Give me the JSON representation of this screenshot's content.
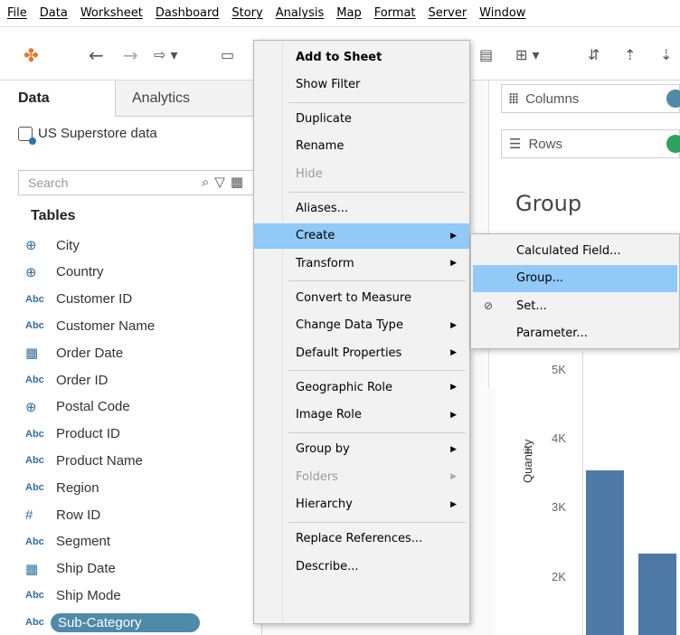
{
  "menubar": [
    "File",
    "Data",
    "Worksheet",
    "Dashboard",
    "Story",
    "Analysis",
    "Map",
    "Format",
    "Server",
    "Window"
  ],
  "tabs": {
    "data": "Data",
    "analytics": "Analytics"
  },
  "datasource": "US Superstore data",
  "search": {
    "placeholder": "Search"
  },
  "tables_header": "Tables",
  "fields": [
    {
      "icon": "globe-icon",
      "type": "geo",
      "label": "City"
    },
    {
      "icon": "globe-icon",
      "type": "geo",
      "label": "Country"
    },
    {
      "icon": "abc-icon",
      "type": "text",
      "label": "Customer ID"
    },
    {
      "icon": "abc-icon",
      "type": "text",
      "label": "Customer Name"
    },
    {
      "icon": "calendar-icon",
      "type": "date",
      "label": "Order Date"
    },
    {
      "icon": "abc-icon",
      "type": "text",
      "label": "Order ID"
    },
    {
      "icon": "globe-icon",
      "type": "geo",
      "label": "Postal Code"
    },
    {
      "icon": "abc-icon",
      "type": "text",
      "label": "Product ID"
    },
    {
      "icon": "abc-icon",
      "type": "text",
      "label": "Product Name"
    },
    {
      "icon": "abc-icon",
      "type": "text",
      "label": "Region"
    },
    {
      "icon": "hash-icon",
      "type": "number",
      "label": "Row ID"
    },
    {
      "icon": "abc-icon",
      "type": "text",
      "label": "Segment"
    },
    {
      "icon": "calendar-icon",
      "type": "date",
      "label": "Ship Date"
    },
    {
      "icon": "abc-icon",
      "type": "text",
      "label": "Ship Mode"
    },
    {
      "icon": "abc-icon",
      "type": "text",
      "label": "Sub-Category",
      "selected": true
    }
  ],
  "icon_glyphs": {
    "abc": "Abc",
    "globe": "⊕",
    "calendar": "📅",
    "hash": "#"
  },
  "shelves": {
    "columns": "Columns",
    "rows": "Rows"
  },
  "sheet_title": "Group",
  "chart": {
    "y_label": "Quantity",
    "ticks": [
      "5K",
      "4K",
      "3K",
      "2K"
    ],
    "bar_color": "#4e79a7",
    "values": [
      3550,
      2340
    ]
  },
  "context_menu": {
    "items": [
      {
        "label": "Add to Sheet",
        "bold": true
      },
      {
        "label": "Show Filter"
      },
      {
        "sep": true
      },
      {
        "label": "Duplicate"
      },
      {
        "label": "Rename"
      },
      {
        "label": "Hide",
        "disabled": true
      },
      {
        "sep": true
      },
      {
        "label": "Aliases..."
      },
      {
        "label": "Create",
        "submenu": true,
        "highlighted": true
      },
      {
        "label": "Transform",
        "submenu": true
      },
      {
        "sep": true
      },
      {
        "label": "Convert to Measure"
      },
      {
        "label": "Change Data Type",
        "submenu": true
      },
      {
        "label": "Default Properties",
        "submenu": true
      },
      {
        "sep": true
      },
      {
        "label": "Geographic Role",
        "submenu": true
      },
      {
        "label": "Image Role",
        "submenu": true
      },
      {
        "sep": true
      },
      {
        "label": "Group by",
        "submenu": true
      },
      {
        "label": "Folders",
        "submenu": true,
        "disabled": true
      },
      {
        "label": "Hierarchy",
        "submenu": true
      },
      {
        "sep": true
      },
      {
        "label": "Replace References..."
      },
      {
        "label": "Describe..."
      }
    ]
  },
  "submenu": {
    "items": [
      {
        "label": "Calculated Field..."
      },
      {
        "label": "Group...",
        "highlighted": true
      },
      {
        "label": "Set...",
        "icon": "set-icon"
      },
      {
        "label": "Parameter..."
      }
    ]
  }
}
